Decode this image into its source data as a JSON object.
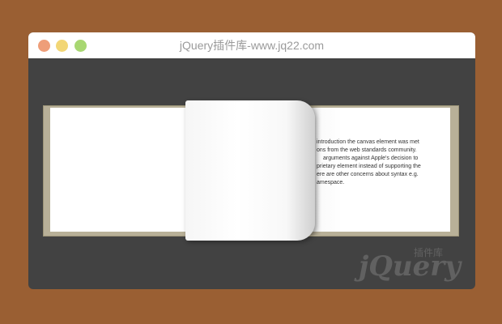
{
  "window": {
    "title": "jQuery插件库-www.jq22.com",
    "controls": {
      "close_color": "#ee9e79",
      "minimize_color": "#f2d676",
      "maximize_color": "#a8d772"
    }
  },
  "book": {
    "right_page_lines": [
      "introduction the canvas element was met",
      "ons from the web standards community.",
      "arguments against Apple's decision to",
      "prietary element instead of supporting the",
      "ere are other concerns about syntax e.g.",
      "amespace."
    ]
  },
  "watermark": {
    "brand": "jQuery",
    "subtitle": "插件库"
  }
}
